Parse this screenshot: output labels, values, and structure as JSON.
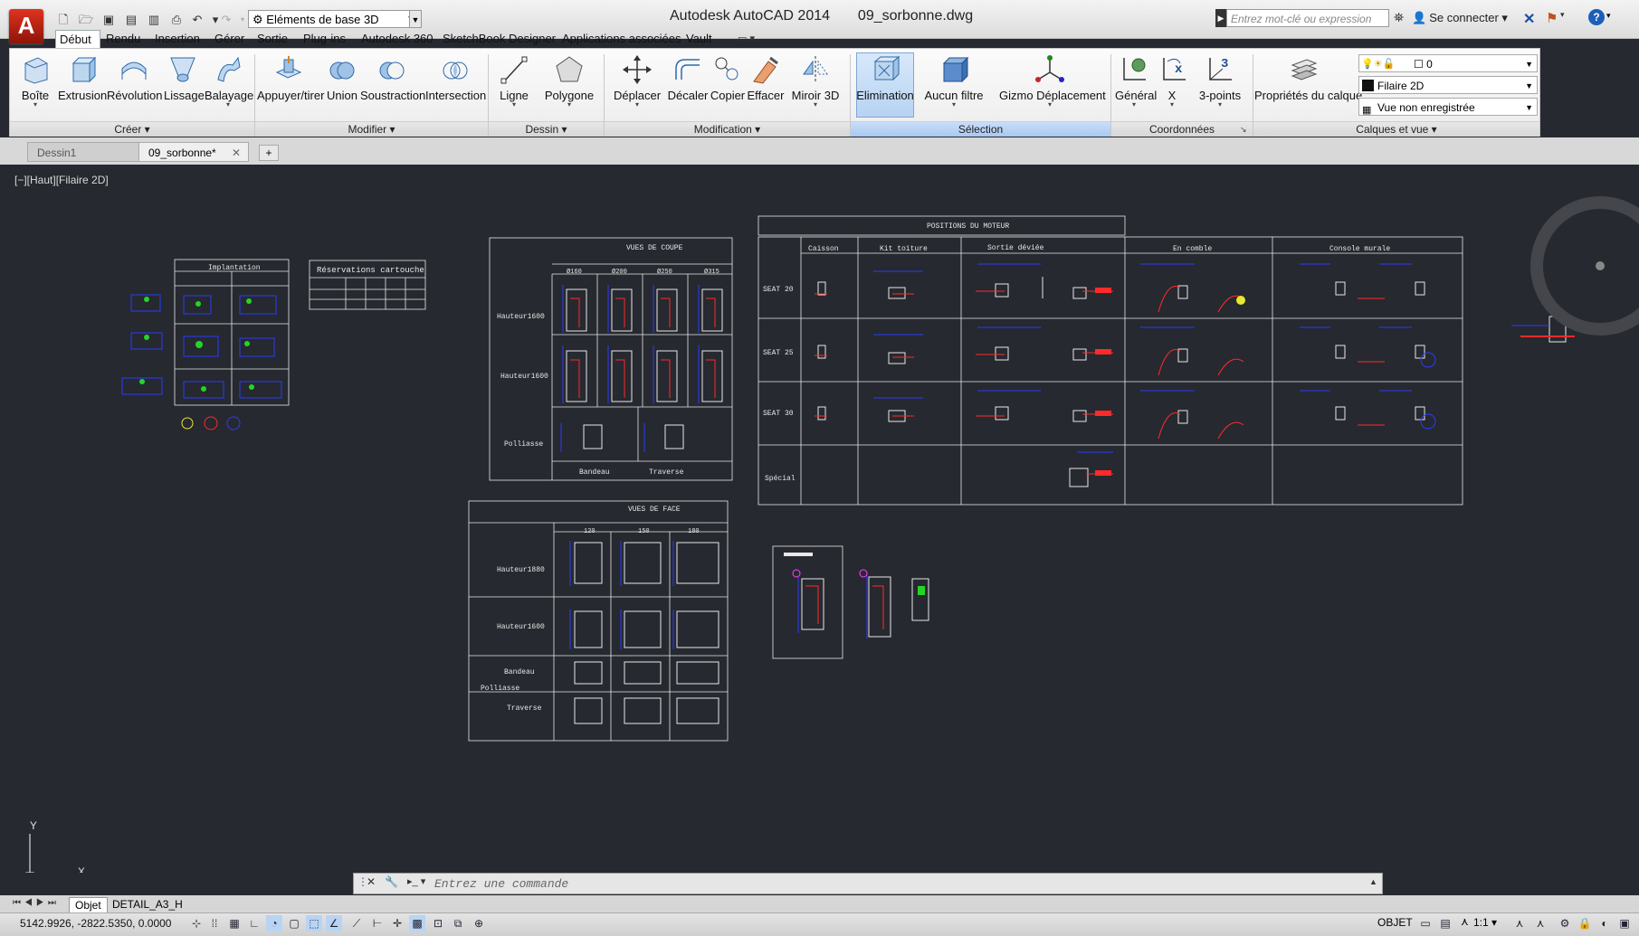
{
  "app": {
    "title": "Autodesk AutoCAD 2014",
    "file": "09_sorbonne.dwg",
    "logo_letter": "A",
    "workspace": "Eléments de base 3D",
    "search_placeholder": "Entrez mot-clé ou expression",
    "signin": "Se connecter"
  },
  "ribbon_tabs": [
    "Début",
    "Rendu",
    "Insertion",
    "Gérer",
    "Sortie",
    "Plug-ins",
    "Autodesk 360",
    "SketchBook Designer",
    "Applications associées",
    "Vault"
  ],
  "active_tab": "Début",
  "tools": {
    "boite": "Boîte",
    "extrusion": "Extrusion",
    "revolution": "Révolution",
    "lissage": "Lissage",
    "balayage": "Balayage",
    "appuyer": "Appuyer/tirer",
    "union": "Union",
    "soustraction": "Soustraction",
    "intersection": "Intersection",
    "ligne": "Ligne",
    "polygone": "Polygone",
    "deplacer": "Déplacer",
    "decaler": "Décaler",
    "copier": "Copier",
    "effacer": "Effacer",
    "miroir": "Miroir 3D",
    "elimination": "Elimination",
    "aucun_filtre": "Aucun filtre",
    "gizmo": "Gizmo Déplacement",
    "general": "Général",
    "x": "X",
    "troispoints": "3-points",
    "proprietes": "Propriétés du calque"
  },
  "panels": {
    "creer": "Créer ▾",
    "modifier": "Modifier ▾",
    "dessin": "Dessin ▾",
    "modification": "Modification ▾",
    "selection": "Sélection",
    "coordonnees": "Coordonnées",
    "calques": "Calques et vue ▾"
  },
  "layer": {
    "current": "0",
    "visual_style": "Filaire 2D",
    "view": "Vue non enregistrée"
  },
  "doc_tabs": [
    "Dessin1",
    "09_sorbonne*"
  ],
  "active_doc": "09_sorbonne*",
  "viewport_label": "[−][Haut][Filaire 2D]",
  "drawing": {
    "implantation_title": "Implantation",
    "reservations_title": "Réservations cartouche",
    "vues_coupe": {
      "title": "VUES DE COUPE",
      "cols": [
        "Ø160",
        "Ø200",
        "Ø250",
        "Ø315"
      ],
      "rows": [
        "Hauteur1600",
        "Hauteur1600",
        "Polliasse"
      ],
      "footer": [
        "Bandeau",
        "Traverse"
      ]
    },
    "vues_face": {
      "title": "VUES DE FACE",
      "cols": [
        "120",
        "150",
        "180"
      ],
      "rows": [
        "Hauteur1880",
        "Hauteur1600",
        "Bandeau",
        "Polliasse",
        "Traverse"
      ]
    },
    "positions": {
      "title": "POSITIONS DU MOTEUR",
      "cols": [
        "Caisson",
        "Kit toiture",
        "Sortie déviée",
        "En comble",
        "Console murale"
      ],
      "rows": [
        "SEAT 20",
        "SEAT 25",
        "SEAT 30",
        "Spécial"
      ]
    }
  },
  "axis": {
    "x": "X",
    "y": "Y"
  },
  "command_placeholder": "Entrez une commande",
  "layout_tabs": [
    "Objet",
    "DETAIL_A3_H"
  ],
  "status": {
    "coords": "5142.9926, -2822.5350, 0.0000",
    "model": "OBJET",
    "scale": "1:1"
  },
  "colors": {
    "canvas": "#26292f",
    "accent": "#1c5fb8",
    "line_white": "#e8e8e8",
    "cad_blue": "#2a3cff",
    "cad_red": "#ff2a2a",
    "cad_green": "#24d524",
    "cad_yellow": "#e8e830",
    "cad_magenta": "#ff40ff"
  }
}
